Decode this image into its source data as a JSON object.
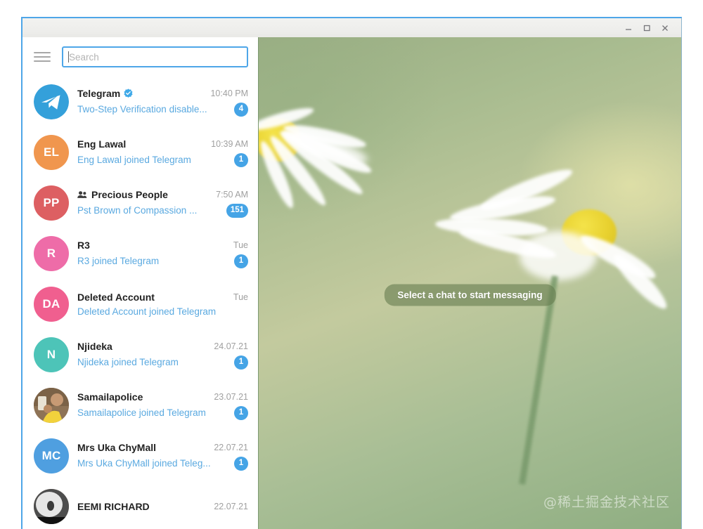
{
  "window": {
    "controls": [
      {
        "name": "minimize",
        "label": "–"
      },
      {
        "name": "maximize",
        "label": "□"
      },
      {
        "name": "close",
        "label": "×"
      }
    ],
    "title": ""
  },
  "sidebar": {
    "menu_icon": "hamburger-menu-icon",
    "search": {
      "placeholder": "Search",
      "value": ""
    },
    "chats": [
      {
        "name": "Telegram",
        "verified": true,
        "group": false,
        "time": "10:40 PM",
        "message": "Two-Step Verification disable...",
        "badge": "4",
        "avatar_type": "logo",
        "avatar_initials": "",
        "avatar_color": "#34a0da"
      },
      {
        "name": "Eng Lawal",
        "verified": false,
        "group": false,
        "time": "10:39 AM",
        "message": "Eng Lawal joined Telegram",
        "badge": "1",
        "avatar_type": "initials",
        "avatar_initials": "EL",
        "avatar_color": "#f0964e"
      },
      {
        "name": "Precious People",
        "verified": false,
        "group": true,
        "time": "7:50 AM",
        "message": "Pst Brown of Compassion ...",
        "badge": "151",
        "avatar_type": "initials",
        "avatar_initials": "PP",
        "avatar_color": "#dd5f62"
      },
      {
        "name": "R3",
        "verified": false,
        "group": false,
        "time": "Tue",
        "message": "R3 joined Telegram",
        "badge": "1",
        "avatar_type": "initials",
        "avatar_initials": "R",
        "avatar_color": "#ee6ca8"
      },
      {
        "name": "Deleted Account",
        "verified": false,
        "group": false,
        "time": "Tue",
        "message": "Deleted Account joined Telegram",
        "badge": "",
        "avatar_type": "initials",
        "avatar_initials": "DA",
        "avatar_color": "#f05f8f"
      },
      {
        "name": "Njideka",
        "verified": false,
        "group": false,
        "time": "24.07.21",
        "message": "Njideka joined Telegram",
        "badge": "1",
        "avatar_type": "initials",
        "avatar_initials": "N",
        "avatar_color": "#4dc4b8"
      },
      {
        "name": "Samailapolice",
        "verified": false,
        "group": false,
        "time": "23.07.21",
        "message": "Samailapolice joined Telegram",
        "badge": "1",
        "avatar_type": "photo",
        "avatar_initials": "",
        "avatar_color": "#c9a36f"
      },
      {
        "name": "Mrs Uka ChyMall",
        "verified": false,
        "group": false,
        "time": "22.07.21",
        "message": "Mrs Uka ChyMall joined Teleg...",
        "badge": "1",
        "avatar_type": "initials",
        "avatar_initials": "MC",
        "avatar_color": "#4f9fe0"
      },
      {
        "name": "EEMI RICHARD",
        "verified": false,
        "group": false,
        "time": "22.07.21",
        "message": "",
        "badge": "",
        "avatar_type": "photo",
        "avatar_initials": "",
        "avatar_color": "#9aa0a6"
      }
    ]
  },
  "main": {
    "empty_state": "Select a chat to start messaging",
    "watermark": "@稀土掘金技术社区"
  },
  "colors": {
    "accent": "#45a4e6",
    "search_border": "#4ea6e8",
    "message_text": "#5aa9e0",
    "name_text": "#222222",
    "time_text": "#a0a0a0",
    "window_border": "#4ea6e8"
  }
}
